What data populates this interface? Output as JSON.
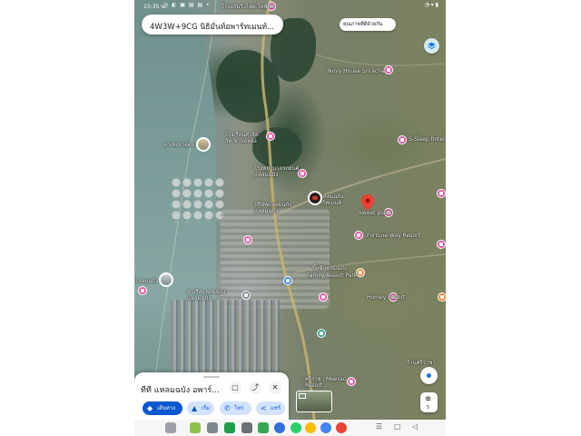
{
  "status_bar": {
    "time": "15:35 น.",
    "left_icons": "◎ ◐ ▣ ▤ ▤ •",
    "right_icons": "◔ ▾ ▮"
  },
  "search": {
    "text": "4W3W+9CG นิธิมั่นท์อพาร์ทเมนท์..."
  },
  "chip": {
    "label": "คุณภาพที่ดีด้วยกัน"
  },
  "map_labels": {
    "novy_house": "Novy House Sriracha",
    "s_sleep": "S-Sleep hotel",
    "cafe_blue": "คาเฟ่เขาอุดม",
    "temple": "โรงเรียนสาธิต\nวัดเขาบ่อทอง",
    "top_label": "โรงแรมวิวไทย ไลฟ์ทัส",
    "hospital": "โรงพยาบาลรถยนต์\nแหลมฉบัง",
    "factory": "บริษัทแหลมฉบัง\nแหลมฉบัง",
    "target_place": "ที่ที่แหลมฉบัง\nอพาร์ทเมนท์",
    "place2": "Sweet place",
    "family_resort": "Family Resort Park",
    "bigC": "บิ๊กซีแหลมฉบัง",
    "homey": "Homey Resort",
    "fortune": "Fortune Way Resort",
    "leamchabang_port": "ท่าเรือแหลมฉบัง\nแหลมฉบัง",
    "laemchabang": "แหลมฉบัง",
    "sriracha_meerac": "ศรีราชา Meerac\nResort",
    "right_label": "ร้านศรีราชา"
  },
  "bottom_card": {
    "title": "ทีที แหลมฉบัง อพาร์...",
    "save_icon": "▢",
    "share_icon": "⤴",
    "close_icon": "✕",
    "directions_label": "เส้นทาง",
    "start_label": "เริ่ม",
    "call_label": "โทร",
    "share_label": "แชร์"
  },
  "pegman_count": "5",
  "colors": {
    "accent": "#0b57d0",
    "poi_pink": "#e357a8",
    "pin_red": "#ea4335"
  },
  "taskbar": {
    "apps": [
      "apps-grid-icon",
      "line-icon",
      "camera-icon",
      "green-shield-icon",
      "settings-icon",
      "maps-icon",
      "messenger-icon",
      "whatsapp-icon",
      "maps-pin-icon",
      "google-icon",
      "photos-icon"
    ],
    "nav": [
      "☰",
      "▢",
      "◁"
    ]
  }
}
